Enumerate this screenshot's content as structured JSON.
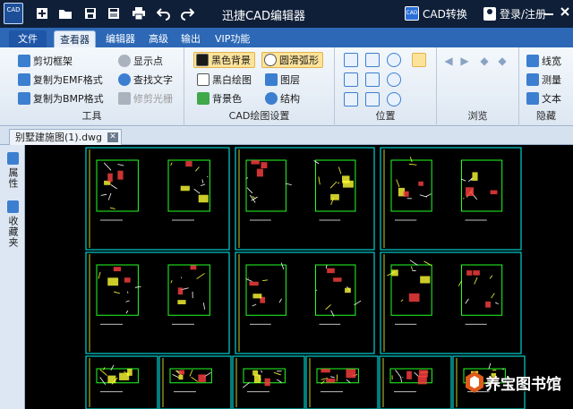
{
  "titlebar": {
    "logo_text": "CAD",
    "title": "迅捷CAD编辑器",
    "cad_convert": "CAD转换",
    "cad_badge": "CAD",
    "login": "登录/注册",
    "icons": [
      "new-file-icon",
      "open-folder-icon",
      "save-icon",
      "save-as-icon",
      "print-icon",
      "undo-icon",
      "redo-icon"
    ],
    "window_controls": [
      "minimize-icon",
      "maximize-icon",
      "close-icon"
    ]
  },
  "tabs": [
    {
      "label": "文件"
    },
    {
      "label": "查看器"
    },
    {
      "label": "编辑器"
    },
    {
      "label": "高级"
    },
    {
      "label": "输出"
    },
    {
      "label": "VIP功能"
    }
  ],
  "ribbon": {
    "tools": {
      "label": "工具",
      "items": [
        {
          "label": "剪切框架",
          "icon": "cut-frame-icon"
        },
        {
          "label": "复制为EMF格式",
          "icon": "copy-emf-icon"
        },
        {
          "label": "复制为BMP格式",
          "icon": "copy-bmp-icon"
        },
        {
          "label": "显示点",
          "icon": "show-points-icon"
        },
        {
          "label": "查找文字",
          "icon": "find-text-icon"
        },
        {
          "label": "修剪光栅",
          "icon": "trim-raster-icon"
        }
      ]
    },
    "cad_settings": {
      "label": "CAD绘图设置",
      "items": [
        {
          "label": "黑色背景",
          "icon": "black-background-icon"
        },
        {
          "label": "黑白绘图",
          "icon": "bw-drawing-icon"
        },
        {
          "label": "背景色",
          "icon": "background-color-icon"
        },
        {
          "label": "圆滑弧形",
          "icon": "smooth-arc-icon"
        },
        {
          "label": "图层",
          "icon": "layers-icon"
        },
        {
          "label": "结构",
          "icon": "structure-icon"
        }
      ]
    },
    "position": {
      "label": "位置"
    },
    "browse": {
      "label": "浏览"
    },
    "hidden": {
      "label": "隐藏",
      "items": [
        {
          "label": "线宽",
          "icon": "line-width-icon"
        },
        {
          "label": "测量",
          "icon": "measure-icon"
        },
        {
          "label": "文本",
          "icon": "text-icon"
        }
      ]
    }
  },
  "document": {
    "tab_label": "别墅建施图(1).dwg",
    "close_glyph": "✕"
  },
  "sidepanel": {
    "items": [
      {
        "label": "属性",
        "icon": "properties-icon"
      },
      {
        "label": "收藏夹",
        "icon": "favorites-icon"
      }
    ]
  },
  "watermark": {
    "text": "养宝图书馆"
  },
  "colors": {
    "titlebar": "#0f1f38",
    "tab_strip": "#2c68b6",
    "canvas": "#000000",
    "drawing_frame": "#00d0d0",
    "drawing_green": "#22ff22",
    "drawing_yellow": "#ffff33"
  }
}
